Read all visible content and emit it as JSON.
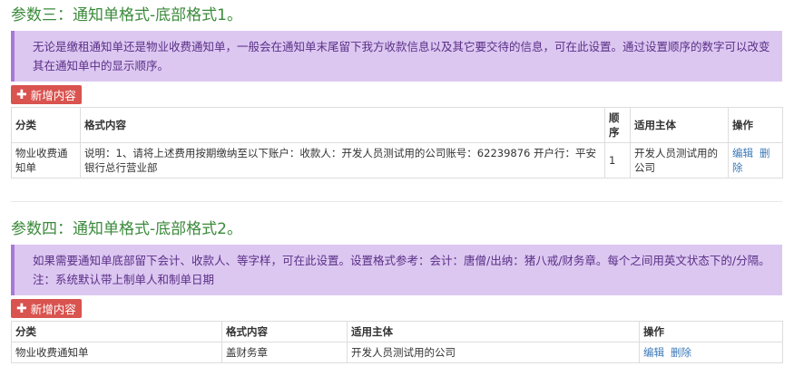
{
  "param3": {
    "title": "参数三：通知单格式-底部格式1。",
    "notice": "无论是缴租通知单还是物业收费通知单，一般会在通知单末尾留下我方收款信息以及其它要交待的信息，可在此设置。通过设置顺序的数字可以改变其在通知单中的显示顺序。",
    "add_label": "新增内容",
    "columns": [
      "分类",
      "格式内容",
      "顺序",
      "适用主体",
      "操作"
    ],
    "rows": [
      {
        "category": "物业收费通知单",
        "content": "说明：1、请将上述费用按期缴纳至以下账户：收款人：开发人员测试用的公司账号：62239876 开户行：平安银行总行营业部",
        "order": "1",
        "subject": "开发人员测试用的公司",
        "edit": "编辑",
        "delete": "删除"
      }
    ]
  },
  "param4": {
    "title": "参数四：通知单格式-底部格式2。",
    "notice": "如果需要通知单底部留下会计、收款人、等字样，可在此设置。设置格式参考：会计：唐僧/出纳：猪八戒/财务章。每个之间用英文状态下的/分隔。注：系统默认带上制单人和制单日期",
    "add_label": "新增内容",
    "columns": [
      "分类",
      "格式内容",
      "适用主体",
      "操作"
    ],
    "rows": [
      {
        "category": "物业收费通知单",
        "content": "盖财务章",
        "subject": "开发人员测试用的公司",
        "edit": "编辑",
        "delete": "删除"
      }
    ]
  },
  "colors": {
    "title_green": "#3a8a3a",
    "notice_bg": "#dcc7f1",
    "notice_border": "#a879d8",
    "notice_text": "#5a2f86",
    "add_button": "#d9534f",
    "link_blue": "#3a78b8"
  },
  "icons": {
    "add": "plus-icon"
  }
}
